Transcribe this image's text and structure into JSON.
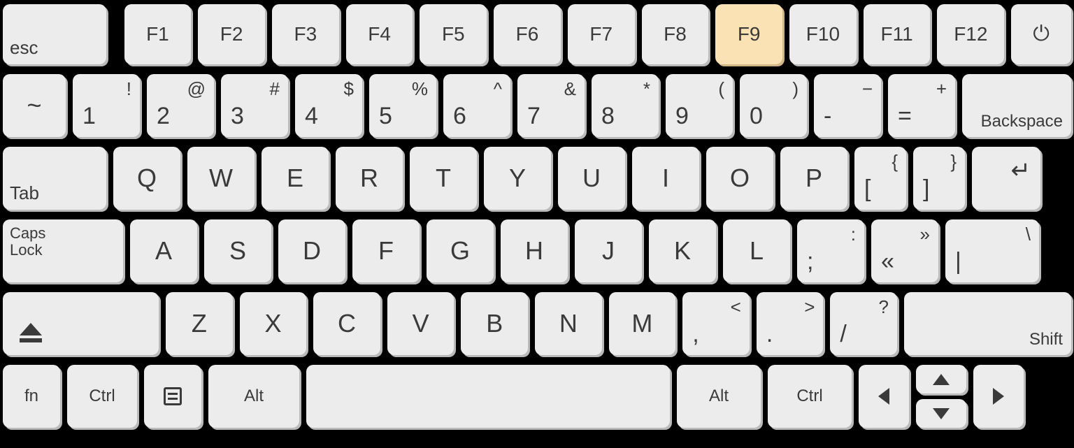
{
  "highlight_key": "F9",
  "row0": {
    "esc": "esc",
    "f": [
      "F1",
      "F2",
      "F3",
      "F4",
      "F5",
      "F6",
      "F7",
      "F8",
      "F9",
      "F10",
      "F11",
      "F12"
    ],
    "power": "⏻"
  },
  "row1": {
    "tilde": {
      "main": "~"
    },
    "nums": [
      {
        "lo": "1",
        "hi": "!"
      },
      {
        "lo": "2",
        "hi": "@"
      },
      {
        "lo": "3",
        "hi": "#"
      },
      {
        "lo": "4",
        "hi": "$"
      },
      {
        "lo": "5",
        "hi": "%"
      },
      {
        "lo": "6",
        "hi": "^"
      },
      {
        "lo": "7",
        "hi": "&"
      },
      {
        "lo": "8",
        "hi": "*"
      },
      {
        "lo": "9",
        "hi": "("
      },
      {
        "lo": "0",
        "hi": ")"
      },
      {
        "lo": "-",
        "hi": "−"
      },
      {
        "lo": "=",
        "hi": "+"
      }
    ],
    "backspace": "Backspace"
  },
  "row2": {
    "tab": "Tab",
    "letters": [
      "Q",
      "W",
      "E",
      "R",
      "T",
      "Y",
      "U",
      "I",
      "O",
      "P"
    ],
    "br1": {
      "lo": "[",
      "hi": "{"
    },
    "br2": {
      "lo": "]",
      "hi": "}"
    },
    "enter": "↵"
  },
  "row3": {
    "caps": "Caps\nLock",
    "letters": [
      "A",
      "S",
      "D",
      "F",
      "G",
      "H",
      "J",
      "K",
      "L"
    ],
    "semi": {
      "lo": ";",
      "hi": ":"
    },
    "quote": {
      "lo": "«",
      "hi": "»"
    },
    "bslash": {
      "lo": "|",
      "hi": "\\"
    }
  },
  "row4": {
    "eject": "eject",
    "letters": [
      "Z",
      "X",
      "C",
      "V",
      "B",
      "N",
      "M"
    ],
    "comma": {
      "lo": ",",
      "hi": "<"
    },
    "period": {
      "lo": ".",
      "hi": ">"
    },
    "slash": {
      "lo": "/",
      "hi": "?"
    },
    "shift": "Shift"
  },
  "row5": {
    "fn": "fn",
    "ctrl1": "Ctrl",
    "menu": "menu",
    "alt1": "Alt",
    "space": " ",
    "alt2": "Alt",
    "ctrl2": "Ctrl"
  }
}
